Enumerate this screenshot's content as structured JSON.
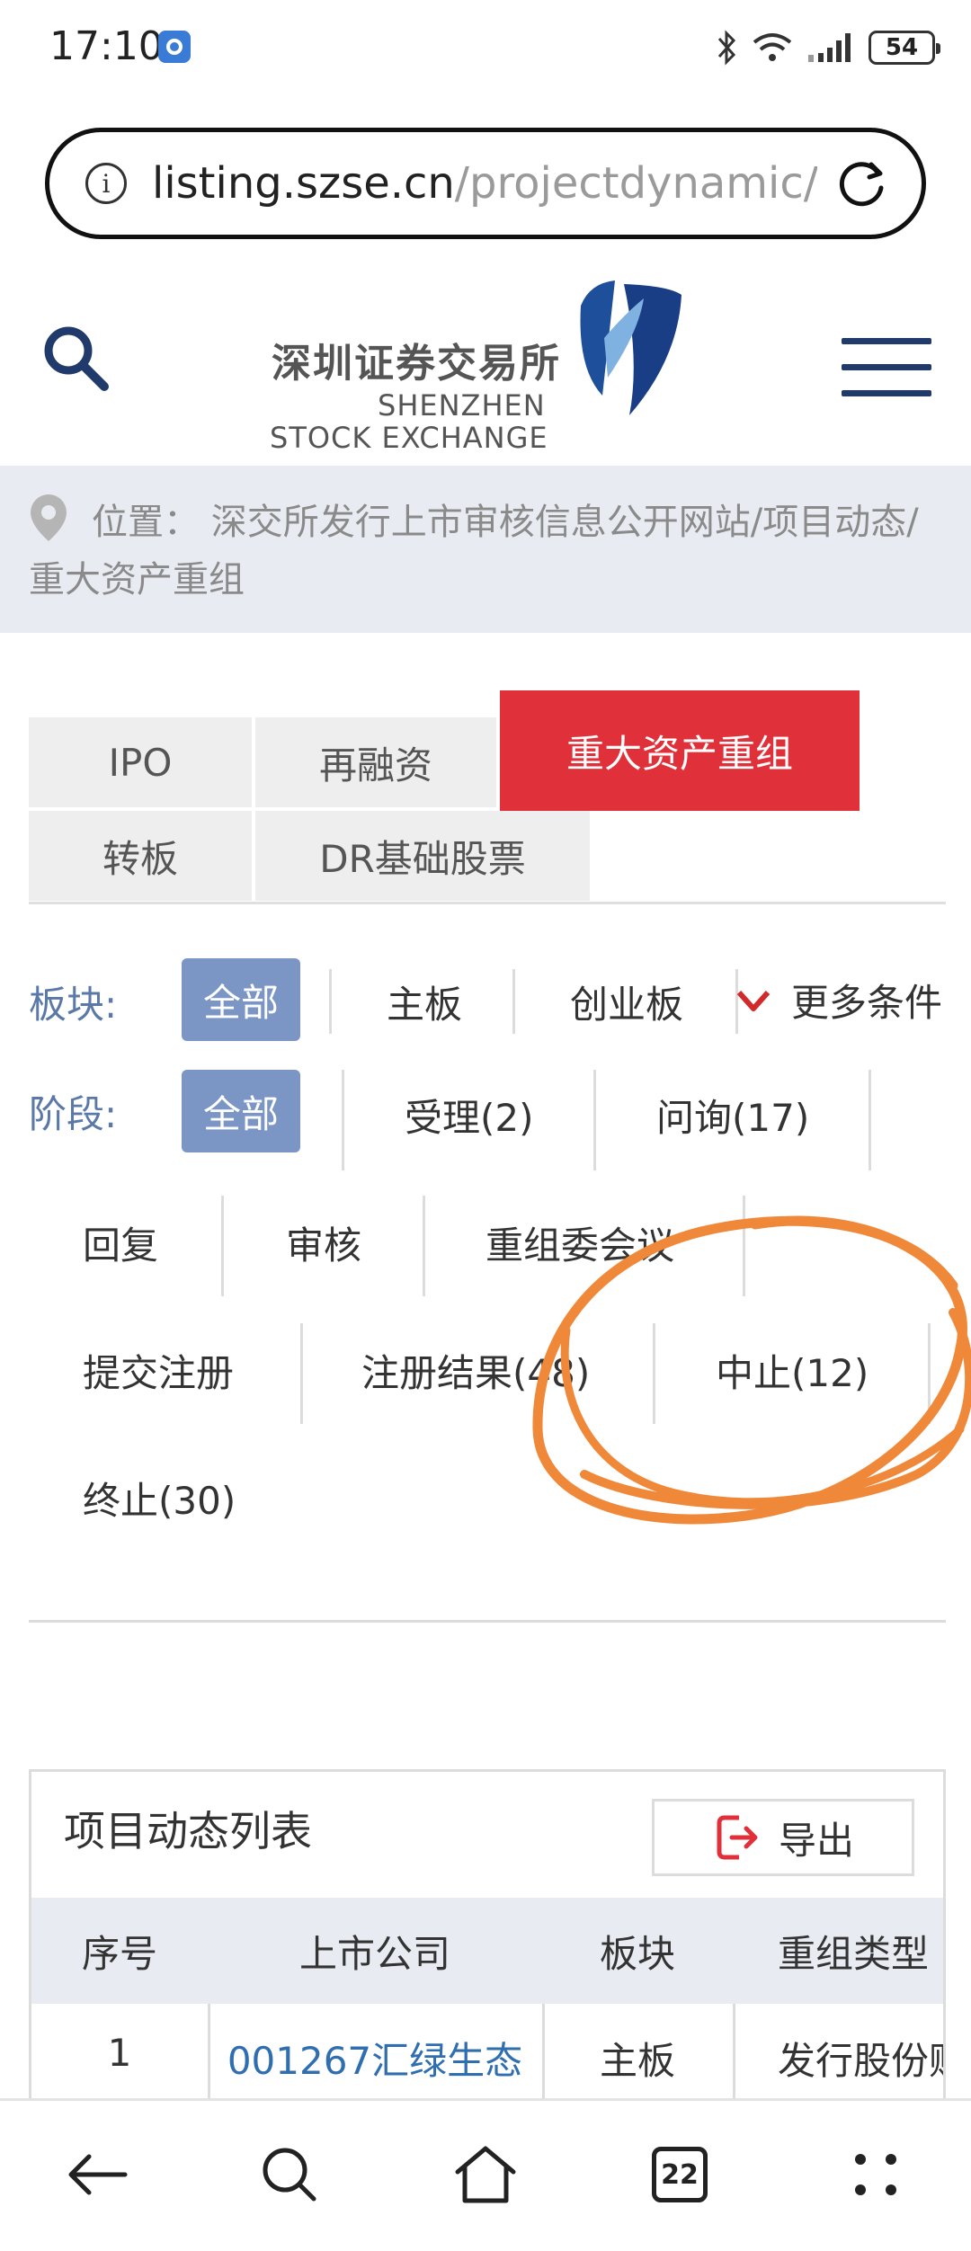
{
  "status_bar": {
    "time": "17:10",
    "battery": "54"
  },
  "browser": {
    "url_domain": "listing.szse.cn",
    "url_path": "/projectdynamic/r",
    "open_tabs": "22"
  },
  "header": {
    "logo_cn": "深圳证券交易所",
    "logo_en_line1": "SHENZHEN",
    "logo_en_line2": "STOCK EXCHANGE"
  },
  "breadcrumb": {
    "text": "位置：  深交所发行上市审核信息公开网站/项目动态/重大资产重组"
  },
  "tabs": [
    {
      "label": "IPO"
    },
    {
      "label": "再融资"
    },
    {
      "label": "重大资产重组"
    },
    {
      "label": "转板"
    },
    {
      "label": "DR基础股票"
    }
  ],
  "filters": {
    "board_label": "板块:",
    "board_options": [
      "全部",
      "主板",
      "创业板"
    ],
    "more_label": "更多条件",
    "stage_label": "阶段:",
    "stage_options": [
      "全部",
      "受理(2)",
      "问询(17)",
      "回复",
      "审核",
      "重组委会议",
      "提交注册",
      "注册结果(48)",
      "中止(12)",
      "终止(30)"
    ]
  },
  "list": {
    "title": "项目动态列表",
    "export_label": "导出",
    "columns": [
      "序号",
      "上市公司",
      "板块",
      "重组类型"
    ],
    "rows": [
      {
        "index": "1",
        "company": "001267汇绿生态",
        "board": "主板",
        "type": "发行股份购买资产"
      }
    ]
  },
  "colors": {
    "active_tab": "#e0313a",
    "chip": "#7b96c4",
    "link": "#2f6fb0",
    "annotation": "#f0883a"
  }
}
